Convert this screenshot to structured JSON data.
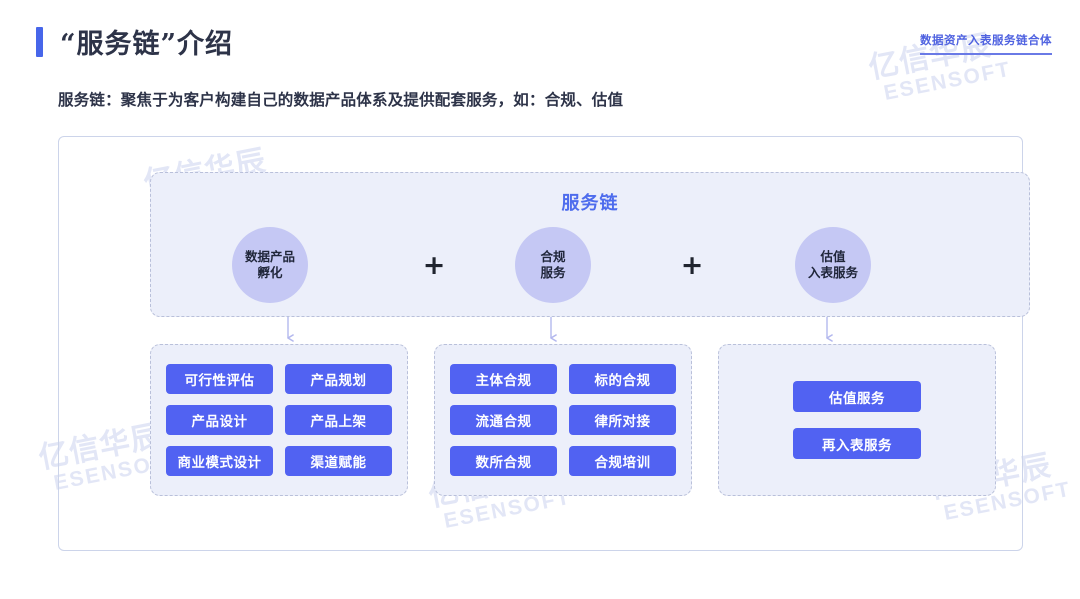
{
  "header": {
    "title": "“服务链”介绍",
    "corner_tag": "数据资产入表服务链合体",
    "accent_color": "#4766ea"
  },
  "subtitle": "服务链：聚焦于为客户构建自己的数据产品体系及提供配套服务，如：合规、估值",
  "diagram": {
    "top_region_label": "服务链",
    "plus_symbol": "+",
    "circles": [
      {
        "line1": "数据产品",
        "line2": "孵化"
      },
      {
        "line1": "合规",
        "line2": "服务"
      },
      {
        "line1": "估值",
        "line2": "入表服务"
      }
    ],
    "groups": [
      {
        "chips": [
          "可行性评估",
          "产品规划",
          "产品设计",
          "产品上架",
          "商业模式设计",
          "渠道赋能"
        ]
      },
      {
        "chips": [
          "主体合规",
          "标的合规",
          "流通合规",
          "律所对接",
          "数所合规",
          "合规培训"
        ]
      },
      {
        "chips": [
          "估值服务",
          "再入表服务"
        ]
      }
    ]
  },
  "watermark": {
    "line1": "亿信华辰",
    "line2": "ESENSOFT"
  },
  "colors": {
    "chip_blue": "#5162f2",
    "circle_lavender": "#c5c8f4",
    "region_fill": "#eceffa",
    "dash_border": "#b9c0da",
    "label_blue": "#4e6ced"
  }
}
